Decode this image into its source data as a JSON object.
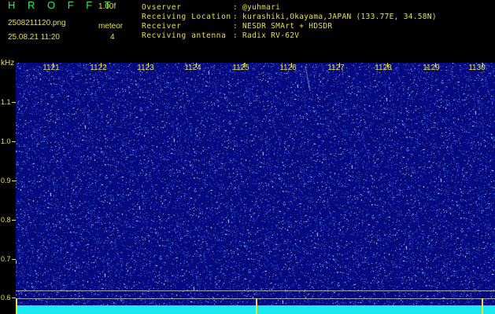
{
  "header": {
    "brand": "H R O F F T",
    "version": "1.00f",
    "filename": "2508211120.png",
    "datetime": "25.08.21 11:20",
    "mode": "meteor",
    "count": "4",
    "info": [
      {
        "label": "Ovserver",
        "value": ": @yuhmari"
      },
      {
        "label": "Receiving Location",
        "value": ": kurashiki,Okayama,JAPAN (133.77E, 34.58N)"
      },
      {
        "label": "Receiver",
        "value": ": NESDR SMArt + HDSDR"
      },
      {
        "label": "Recviving antenna",
        "value": ": Radix RV-62V"
      }
    ]
  },
  "xaxis": {
    "labels": [
      "1121",
      "1122",
      "1123",
      "1124",
      "1125",
      "1126",
      "1127",
      "1128",
      "1129",
      "1130"
    ]
  },
  "yaxis": {
    "unit": "kHz",
    "labels": [
      "1.1",
      "1.0",
      "0.9",
      "0.8",
      "0.7",
      "0.6"
    ]
  },
  "colors": {
    "background": "#0a0e8a",
    "text": "#e8e33a",
    "brand": "#2ee85a",
    "floor": "#19e8f0"
  }
}
